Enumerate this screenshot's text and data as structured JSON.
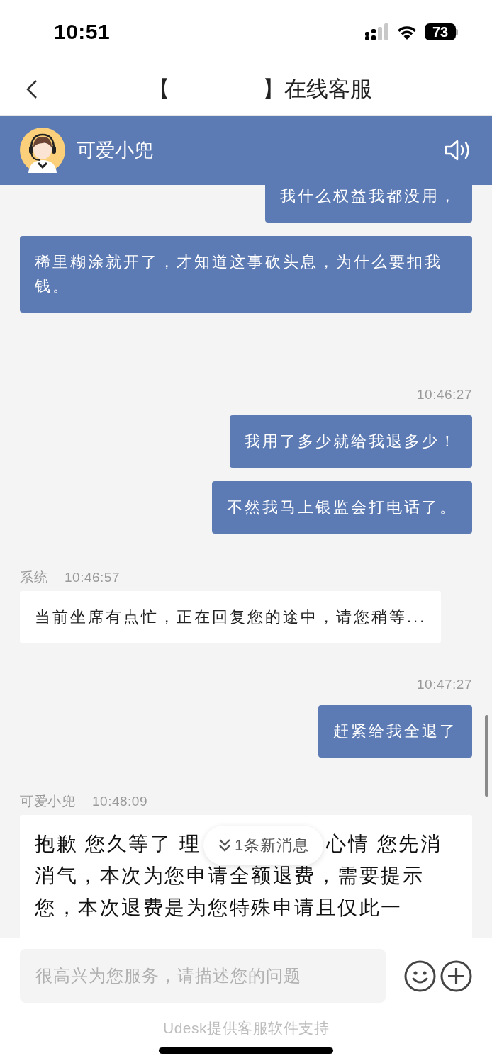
{
  "status_bar": {
    "time": "10:51",
    "battery": "73"
  },
  "nav_bar": {
    "title_start": "【",
    "title_end": "】在线客服"
  },
  "agent_header": {
    "name": "可爱小兜"
  },
  "messages": [
    {
      "kind": "outgoing",
      "text": "我什么权益我都没用，"
    },
    {
      "kind": "outgoing",
      "text": "稀里糊涂就开了，才知道这事砍头息，为什么要扣我钱。"
    },
    {
      "kind": "timestamp",
      "text": "10:46:27"
    },
    {
      "kind": "outgoing",
      "text": "我用了多少就给我退多少！"
    },
    {
      "kind": "outgoing",
      "text": "不然我马上银监会打电话了。"
    },
    {
      "kind": "incoming",
      "sender": "系统",
      "time": "10:46:57",
      "text": "当前坐席有点忙，正在回复您的途中，请您稍等..."
    },
    {
      "kind": "timestamp",
      "text": "10:47:27"
    },
    {
      "kind": "outgoing",
      "text": "赶紧给我全退了"
    },
    {
      "kind": "incoming_large",
      "sender": "可爱小兜",
      "time": "10:48:09",
      "lines": [
        [
          "抱歉 您久等了 理",
          "心情 您先消"
        ],
        [
          "消气，本次为您申请全额退费，需要提示"
        ],
        [
          "您，本次退费是为您特殊申请且仅此一"
        ]
      ]
    }
  ],
  "new_message_pill": {
    "text": "1条新消息"
  },
  "input_bar": {
    "placeholder": "很高兴为您服务，请描述您的问题"
  },
  "footer": {
    "text": "Udesk提供客服软件支持"
  }
}
